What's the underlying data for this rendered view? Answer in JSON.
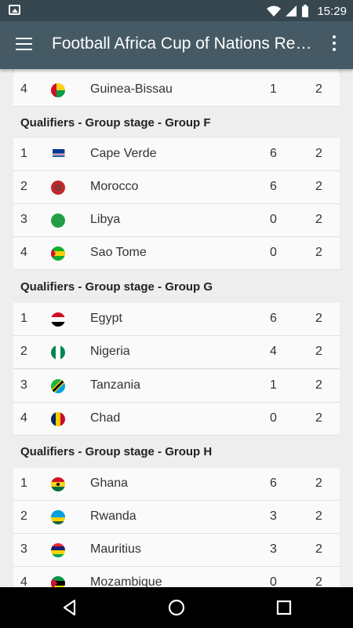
{
  "status_bar": {
    "time": "15:29"
  },
  "app_bar": {
    "title": "Football Africa Cup of Nations Results…"
  },
  "top_partial_row": {
    "pos": "4",
    "name": "Guinea-Bissau",
    "pts": "1",
    "played": "2"
  },
  "groups": [
    {
      "label": "Qualifiers - Group stage - Group F",
      "teams": [
        {
          "pos": "1",
          "name": "Cape Verde",
          "pts": "6",
          "played": "2"
        },
        {
          "pos": "2",
          "name": "Morocco",
          "pts": "6",
          "played": "2"
        },
        {
          "pos": "3",
          "name": "Libya",
          "pts": "0",
          "played": "2"
        },
        {
          "pos": "4",
          "name": "Sao Tome",
          "pts": "0",
          "played": "2"
        }
      ]
    },
    {
      "label": "Qualifiers - Group stage - Group G",
      "teams": [
        {
          "pos": "1",
          "name": "Egypt",
          "pts": "6",
          "played": "2"
        },
        {
          "pos": "2",
          "name": "Nigeria",
          "pts": "4",
          "played": "2"
        },
        {
          "pos": "3",
          "name": "Tanzania",
          "pts": "1",
          "played": "2"
        },
        {
          "pos": "4",
          "name": "Chad",
          "pts": "0",
          "played": "2"
        }
      ]
    },
    {
      "label": "Qualifiers - Group stage - Group H",
      "teams": [
        {
          "pos": "1",
          "name": "Ghana",
          "pts": "6",
          "played": "2"
        },
        {
          "pos": "2",
          "name": "Rwanda",
          "pts": "3",
          "played": "2"
        },
        {
          "pos": "3",
          "name": "Mauritius",
          "pts": "3",
          "played": "2"
        },
        {
          "pos": "4",
          "name": "Mozambique",
          "pts": "0",
          "played": "2"
        }
      ]
    }
  ]
}
